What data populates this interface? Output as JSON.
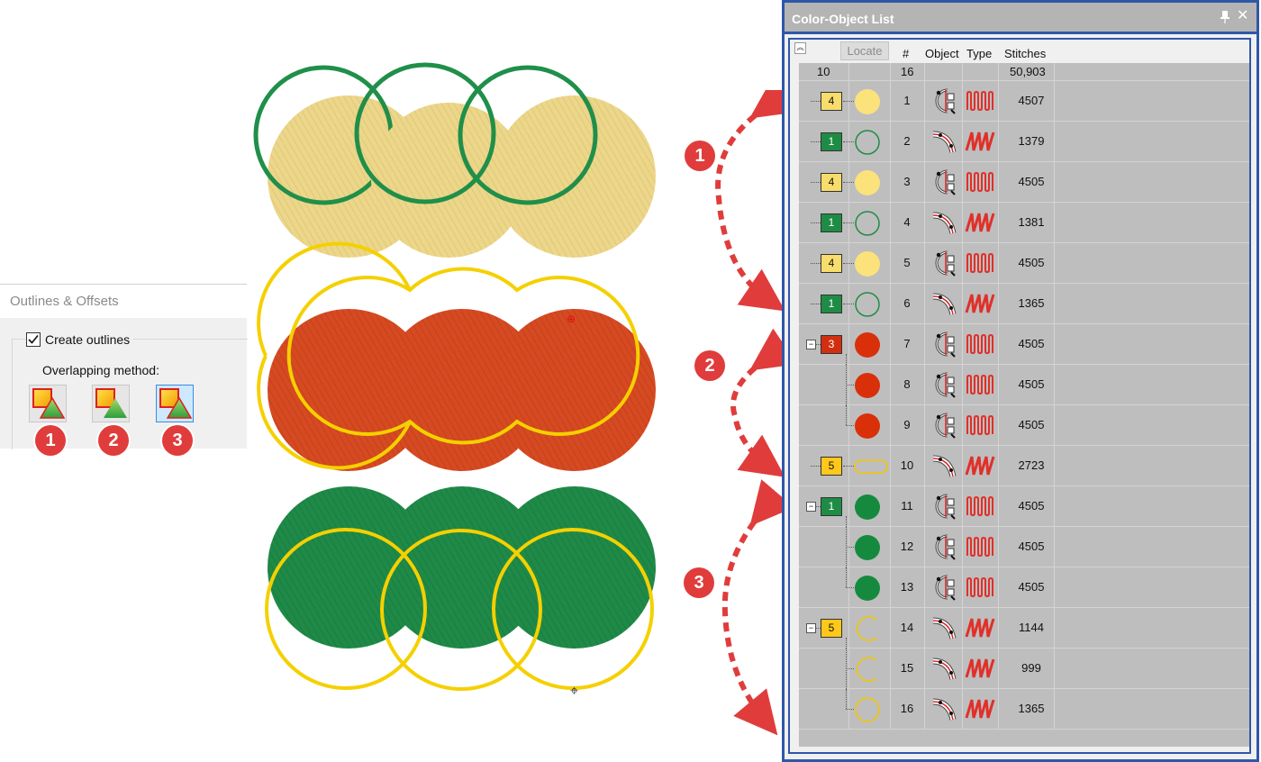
{
  "outlines_panel": {
    "title": "Outlines & Offsets",
    "create_outlines_label": "Create outlines",
    "create_outlines_checked": true,
    "overlapping_method_label": "Overlapping method:",
    "methods": [
      "1",
      "2",
      "3"
    ],
    "selected_method": "3"
  },
  "callouts": [
    "1",
    "2",
    "3"
  ],
  "color_object_list": {
    "title": "Color-Object List",
    "locate_label": "Locate",
    "columns": {
      "number": "#",
      "object": "Object",
      "type": "Type",
      "stitches": "Stitches"
    },
    "summary": {
      "colors": "10",
      "objects": "16",
      "stitches": "50,903"
    },
    "rows": [
      {
        "color_number": "4",
        "color": "#f8dd6c",
        "shape": "disc",
        "shape_color": "#fbe27a",
        "object": "arc-icon",
        "type": "satin",
        "number": "1",
        "stitches": "4507"
      },
      {
        "color_number": "1",
        "color": "#1e8c45",
        "shape": "ring",
        "shape_color": "#1e8c45",
        "object": "curve-icon",
        "type": "zigzag",
        "number": "2",
        "stitches": "1379"
      },
      {
        "color_number": "4",
        "color": "#f8dd6c",
        "shape": "disc",
        "shape_color": "#fbe27a",
        "object": "arc-icon",
        "type": "satin",
        "number": "3",
        "stitches": "4505"
      },
      {
        "color_number": "1",
        "color": "#1e8c45",
        "shape": "ring",
        "shape_color": "#1e8c45",
        "object": "curve-icon",
        "type": "zigzag",
        "number": "4",
        "stitches": "1381"
      },
      {
        "color_number": "4",
        "color": "#f8dd6c",
        "shape": "disc",
        "shape_color": "#fbe27a",
        "object": "arc-icon",
        "type": "satin",
        "number": "5",
        "stitches": "4505"
      },
      {
        "color_number": "1",
        "color": "#1e8c45",
        "shape": "ring",
        "shape_color": "#1e8c45",
        "object": "curve-icon",
        "type": "zigzag",
        "number": "6",
        "stitches": "1365"
      },
      {
        "color_number": "3",
        "color": "#d12f0f",
        "shape": "disc",
        "shape_color": "#d9300a",
        "object": "arc-icon",
        "type": "satin",
        "number": "7",
        "stitches": "4505",
        "group_start": true
      },
      {
        "color_number": "",
        "color": "",
        "shape": "disc",
        "shape_color": "#d9300a",
        "object": "arc-icon",
        "type": "satin",
        "number": "8",
        "stitches": "4505",
        "child": true
      },
      {
        "color_number": "",
        "color": "",
        "shape": "disc",
        "shape_color": "#d9300a",
        "object": "arc-icon",
        "type": "satin",
        "number": "9",
        "stitches": "4505",
        "child": true,
        "last_child": true
      },
      {
        "color_number": "5",
        "color": "#ffc81a",
        "shape": "pill",
        "shape_color": "#f5c400",
        "object": "curve-icon",
        "type": "zigzag",
        "number": "10",
        "stitches": "2723"
      },
      {
        "color_number": "1",
        "color": "#1e8c45",
        "shape": "disc",
        "shape_color": "#158a3e",
        "object": "arc-icon",
        "type": "satin",
        "number": "11",
        "stitches": "4505",
        "group_start": true
      },
      {
        "color_number": "",
        "color": "",
        "shape": "disc",
        "shape_color": "#158a3e",
        "object": "arc-icon",
        "type": "satin",
        "number": "12",
        "stitches": "4505",
        "child": true
      },
      {
        "color_number": "",
        "color": "",
        "shape": "disc",
        "shape_color": "#158a3e",
        "object": "arc-icon",
        "type": "satin",
        "number": "13",
        "stitches": "4505",
        "child": true,
        "last_child": true
      },
      {
        "color_number": "5",
        "color": "#ffc81a",
        "shape": "arc-open",
        "shape_color": "#f5c400",
        "object": "curve-icon",
        "type": "zigzag",
        "number": "14",
        "stitches": "1144",
        "group_start": true
      },
      {
        "color_number": "",
        "color": "",
        "shape": "arc-open",
        "shape_color": "#f5c400",
        "object": "curve-icon",
        "type": "zigzag",
        "number": "15",
        "stitches": "999",
        "child": true
      },
      {
        "color_number": "",
        "color": "",
        "shape": "ring",
        "shape_color": "#f5c400",
        "object": "curve-icon",
        "type": "zigzag",
        "number": "16",
        "stitches": "1365",
        "child": true,
        "last_child": true
      }
    ]
  },
  "colors": {
    "yellow_fill": "#ecd68a",
    "green_ring": "#1f8f4a",
    "red_fill": "#d64a22",
    "yellow_outline": "#f5d000",
    "green_fill": "#1f8a48",
    "callout_red": "#e03c3c",
    "window_blue": "#2e57a8"
  }
}
